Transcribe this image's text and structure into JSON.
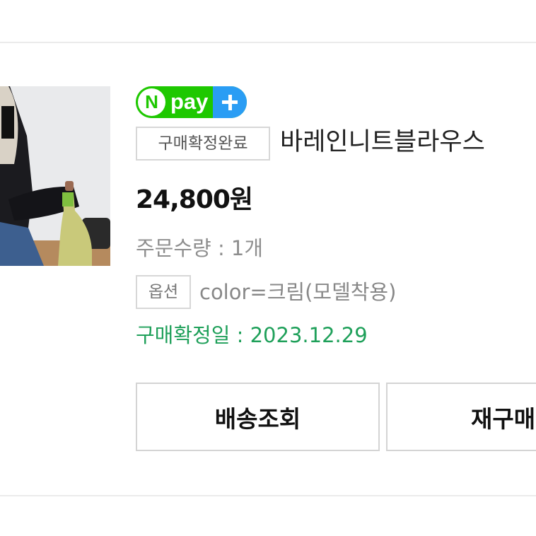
{
  "order": {
    "payment_badge": {
      "n": "N",
      "text": "pay"
    },
    "status_label": "구매확정완료",
    "product_name": "바레인니트블라우스",
    "price": "24,800원",
    "quantity": "주문수량 : 1개",
    "option_label": "옵션",
    "option_value": "color=크림(모델착용)",
    "confirm_date": "구매확정일 : 2023.12.29",
    "buttons": {
      "track": "배송조회",
      "rebuy": "재구매"
    }
  },
  "colors": {
    "npay_green": "#1ec800",
    "npay_blue": "#2a9df4",
    "confirm_green": "#1fa05a"
  }
}
